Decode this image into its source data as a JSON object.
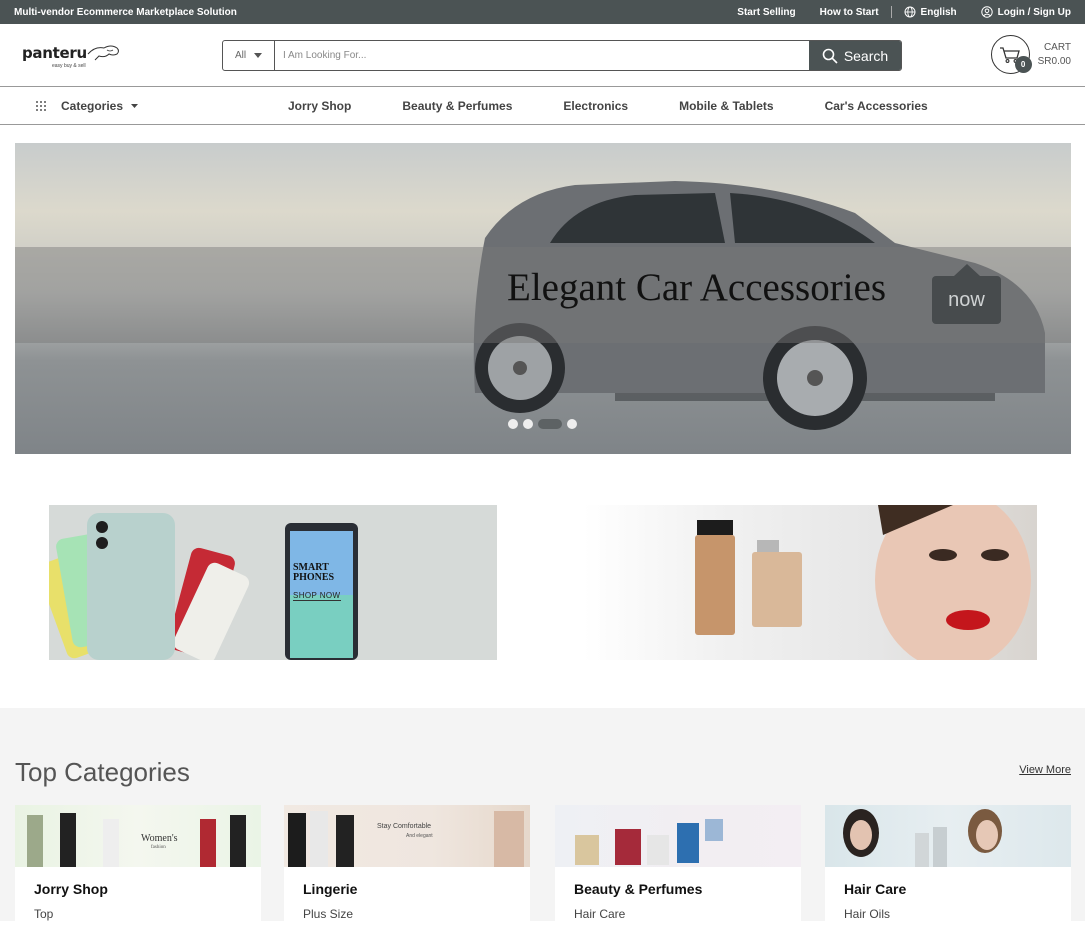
{
  "topbar": {
    "tagline": "Multi-vendor Ecommerce Marketplace Solution",
    "start_selling": "Start Selling",
    "how_to_start": "How to Start",
    "language": "English",
    "login": "Login / Sign Up"
  },
  "header": {
    "logo_text": "panteru",
    "logo_tagline": "easy buy & sell",
    "search_category": "All",
    "search_placeholder": "I Am Looking For...",
    "search_button": "Search",
    "cart_label": "CART",
    "cart_total": "SR0.00",
    "cart_count": "0"
  },
  "nav": {
    "categories_label": "Categories",
    "links": [
      "Jorry Shop",
      "Beauty & Perfumes",
      "Electronics",
      "Mobile & Tablets",
      "Car's Accessories"
    ]
  },
  "hero": {
    "title": "Elegant Car Accessories",
    "badge": "now",
    "slides": 4,
    "active_slide": 2
  },
  "promos": {
    "left_title_line1": "SMART",
    "left_title_line2": "PHONES",
    "left_cta": "SHOP NOW",
    "right_alt": ""
  },
  "top_categories": {
    "title": "Top Categories",
    "view_more": "View More",
    "cards": [
      {
        "title": "Jorry Shop",
        "sub": "Top",
        "banner_text": "Women's",
        "banner_sub": "fashion"
      },
      {
        "title": "Lingerie",
        "sub": "Plus Size",
        "banner_text": "Stay Comfortable",
        "banner_sub": "And elegant"
      },
      {
        "title": "Beauty & Perfumes",
        "sub": "Hair Care",
        "banner_text": "",
        "banner_sub": ""
      },
      {
        "title": "Hair Care",
        "sub": "Hair Oils",
        "banner_text": "",
        "banner_sub": ""
      }
    ]
  },
  "colors": {
    "topbar_bg": "#4b5354",
    "search_button_bg": "#4b5354",
    "section_bg": "#f4f4f4"
  }
}
